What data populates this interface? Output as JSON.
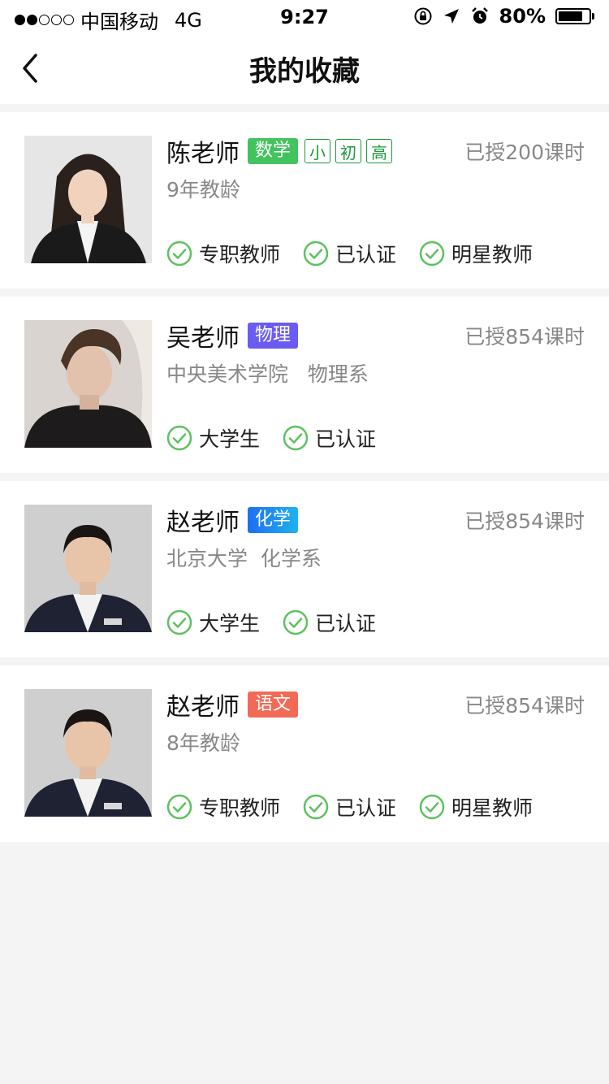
{
  "status_bar": {
    "carrier": "中国移动",
    "network": "4G",
    "time": "9:27",
    "battery_percent": "80%",
    "battery_level": 0.8,
    "signal_bars": 2,
    "icons": [
      "orientation-lock-icon",
      "location-arrow-icon",
      "alarm-icon"
    ]
  },
  "nav": {
    "title": "我的收藏",
    "back_icon": "chevron-left-icon"
  },
  "colors": {
    "accent_green": "#1a9b39",
    "check_green": "#5cc25e"
  },
  "teachers": [
    {
      "name": "陈老师",
      "subject": "数学",
      "subject_color": "#43c35e",
      "levels": [
        "小",
        "初",
        "高"
      ],
      "hours": "已授200课时",
      "sub_info": "9年教龄",
      "badges": [
        "专职教师",
        "已认证",
        "明星教师"
      ]
    },
    {
      "name": "吴老师",
      "subject": "物理",
      "subject_color": "#6a5cf0",
      "levels": [],
      "hours": "已授854课时",
      "sub_info": "中央美术学院   物理系",
      "badges": [
        "大学生",
        "已认证"
      ]
    },
    {
      "name": "赵老师",
      "subject": "化学",
      "subject_color": "#1e8ef0",
      "levels": [],
      "hours": "已授854课时",
      "sub_info": "北京大学  化学系",
      "badges": [
        "大学生",
        "已认证"
      ]
    },
    {
      "name": "赵老师",
      "subject": "语文",
      "subject_color": "#f26a55",
      "levels": [],
      "hours": "已授854课时",
      "sub_info": "8年教龄",
      "badges": [
        "专职教师",
        "已认证",
        "明星教师"
      ]
    }
  ]
}
